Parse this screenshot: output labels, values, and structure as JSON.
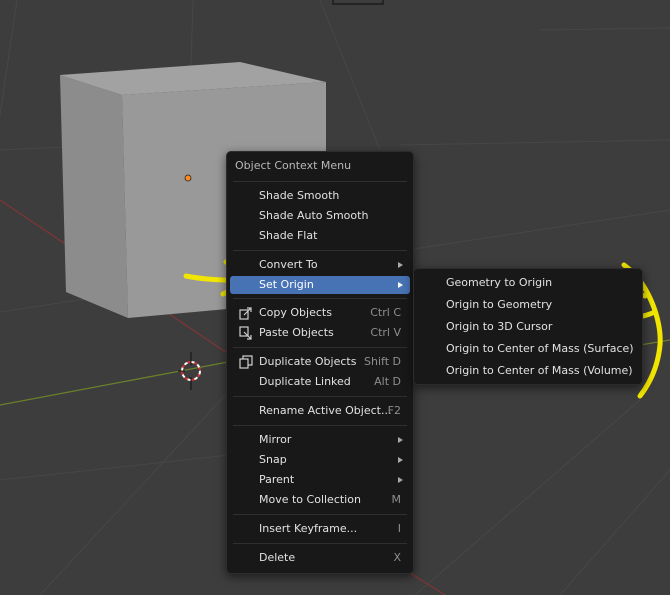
{
  "context_menu": {
    "title": "Object Context Menu",
    "items": [
      {
        "label": "Shade Smooth",
        "shortcut": "",
        "submenu": false
      },
      {
        "label": "Shade Auto Smooth",
        "shortcut": "",
        "submenu": false
      },
      {
        "label": "Shade Flat",
        "shortcut": "",
        "submenu": false
      },
      {
        "label": "Convert To",
        "shortcut": "",
        "submenu": true
      },
      {
        "label": "Set Origin",
        "shortcut": "",
        "submenu": true,
        "active": true
      },
      {
        "label": "Copy Objects",
        "shortcut": "Ctrl C",
        "icon": "copy-icon"
      },
      {
        "label": "Paste Objects",
        "shortcut": "Ctrl V",
        "icon": "paste-icon"
      },
      {
        "label": "Duplicate Objects",
        "shortcut": "Shift D",
        "icon": "duplicate-icon"
      },
      {
        "label": "Duplicate Linked",
        "shortcut": "Alt D"
      },
      {
        "label": "Rename Active Object...",
        "shortcut": "F2"
      },
      {
        "label": "Mirror",
        "shortcut": "",
        "submenu": true
      },
      {
        "label": "Snap",
        "shortcut": "",
        "submenu": true
      },
      {
        "label": "Parent",
        "shortcut": "",
        "submenu": true
      },
      {
        "label": "Move to Collection",
        "shortcut": "M"
      },
      {
        "label": "Insert Keyframe...",
        "shortcut": "I"
      },
      {
        "label": "Delete",
        "shortcut": "X"
      }
    ]
  },
  "set_origin_submenu": {
    "items": [
      "Geometry to Origin",
      "Origin to Geometry",
      "Origin to 3D Cursor",
      "Origin to Center of Mass (Surface)",
      "Origin to Center of Mass (Volume)"
    ]
  },
  "colors": {
    "viewport_bg": "#3d3d3d",
    "menu_bg": "#181818",
    "highlight": "#4772b3",
    "annotation": "#f2e600",
    "x_axis": "#8a3a3a",
    "y_axis": "#6a8a2a",
    "origin_dot": "#ff8a1f"
  }
}
